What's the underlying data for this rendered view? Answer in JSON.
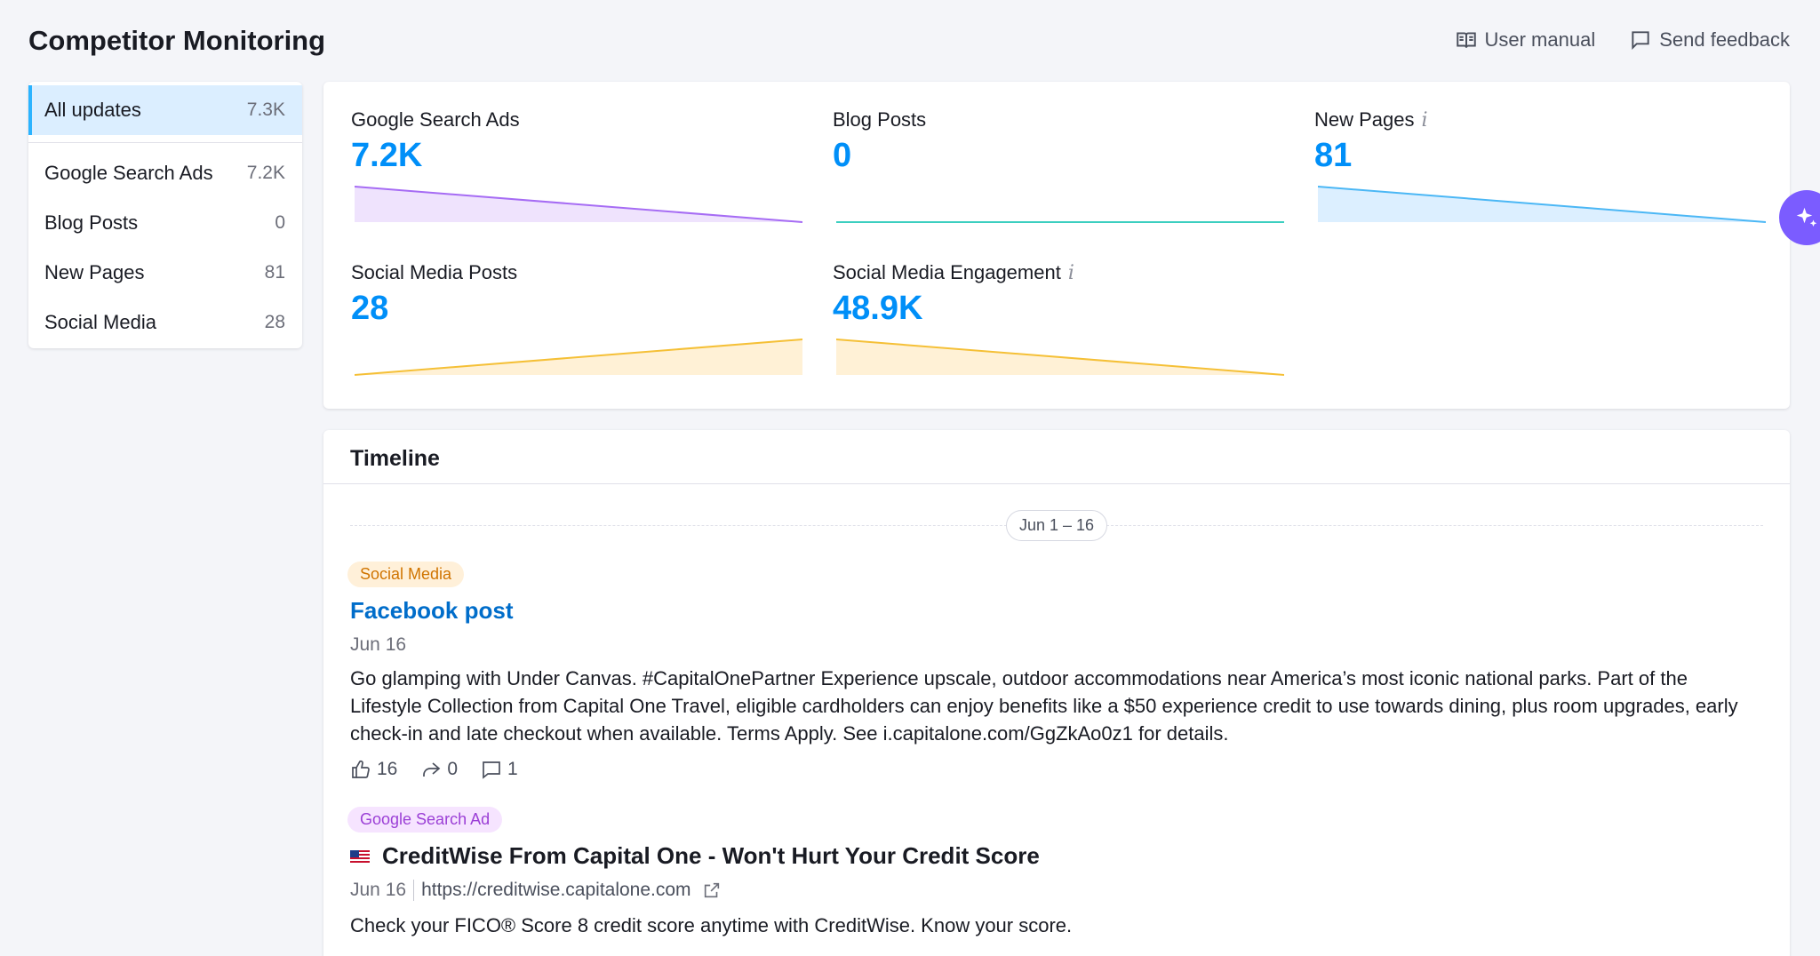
{
  "header": {
    "title": "Competitor Monitoring",
    "user_manual": "User manual",
    "send_feedback": "Send feedback"
  },
  "sidebar": {
    "items": [
      {
        "label": "All updates",
        "count": "7.3K",
        "active": true
      },
      {
        "label": "Google Search Ads",
        "count": "7.2K"
      },
      {
        "label": "Blog Posts",
        "count": "0"
      },
      {
        "label": "New Pages",
        "count": "81"
      },
      {
        "label": "Social Media",
        "count": "28"
      }
    ]
  },
  "stats": [
    {
      "label": "Google Search Ads",
      "value": "7.2K",
      "color": "#a66cf4",
      "fill": "#efe3fd",
      "trend": "down"
    },
    {
      "label": "Blog Posts",
      "value": "0",
      "color": "#3ccfc0",
      "fill": "#ffffff",
      "trend": "flat"
    },
    {
      "label": "New Pages",
      "value": "81",
      "info": "i",
      "color": "#4bb7f5",
      "fill": "#dcefff",
      "trend": "down"
    },
    {
      "label": "Social Media Posts",
      "value": "28",
      "color": "#f5c037",
      "fill": "#fff1d6",
      "trend": "up"
    },
    {
      "label": "Social Media Engagement",
      "value": "48.9K",
      "info": "i",
      "color": "#f5c037",
      "fill": "#fff1d6",
      "trend": "down"
    }
  ],
  "timeline": {
    "title": "Timeline",
    "date_range": "Jun 1 – 16",
    "entries": [
      {
        "tag": "Social Media",
        "title": "Facebook post",
        "date": "Jun 16",
        "body": "Go glamping with Under Canvas. #CapitalOnePartner Experience upscale, outdoor accommodations near America’s most iconic national parks. Part of the Lifestyle Collection from Capital One Travel, eligible cardholders can enjoy benefits like a $50 experience credit to use towards dining, plus room upgrades, early check-in and late checkout when available. Terms Apply. See i.capitalone.com/GgZkAo0z1 for details.",
        "likes": "16",
        "shares": "0",
        "comments": "1"
      },
      {
        "tag": "Google Search Ad",
        "title": "CreditWise From Capital One - Won't Hurt Your Credit Score",
        "date": "Jun 16",
        "url": "https://creditwise.capitalone.com",
        "body": "Check your FICO® Score 8 credit score anytime with CreditWise. Know your score."
      }
    ]
  }
}
